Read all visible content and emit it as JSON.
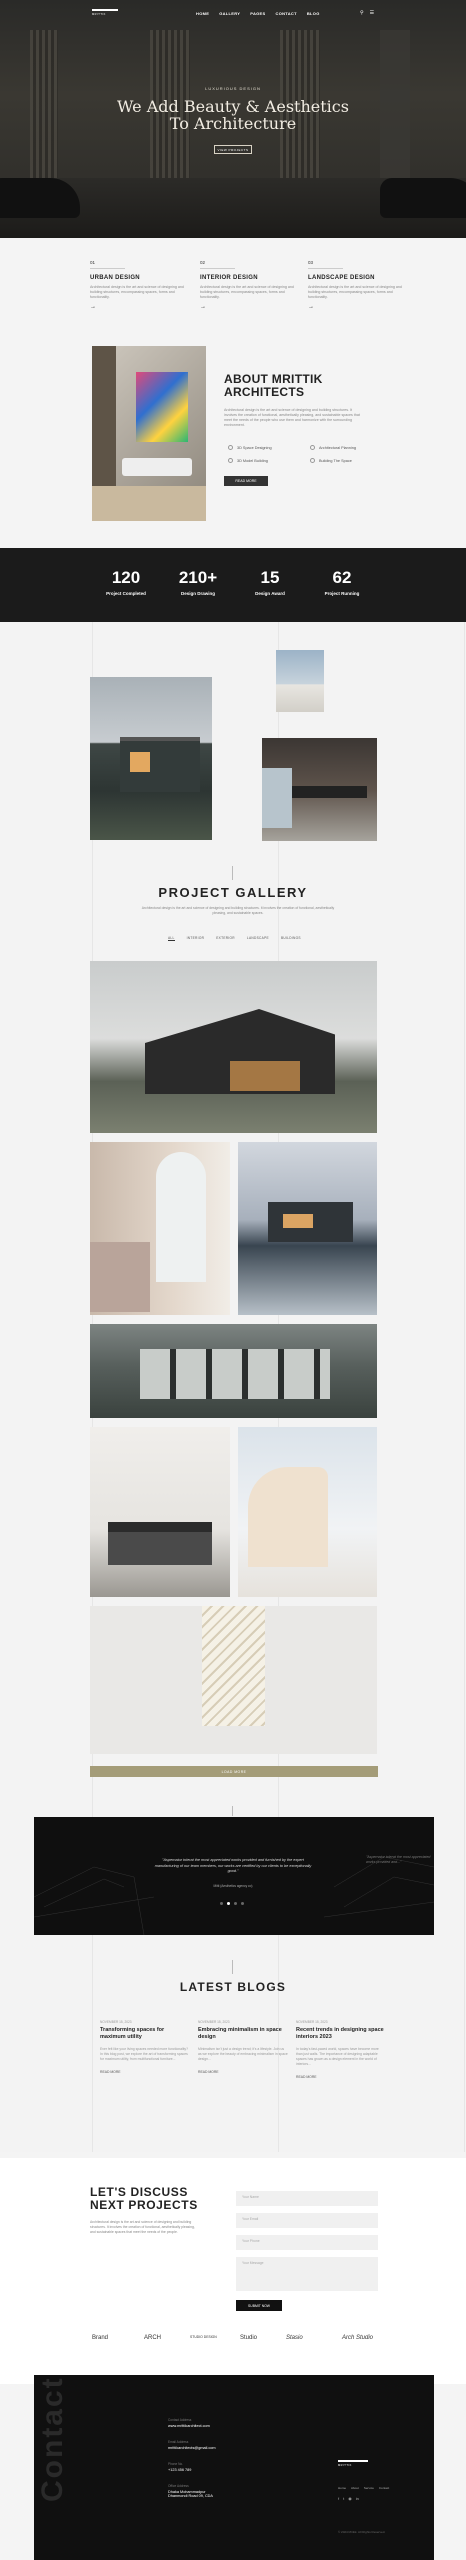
{
  "header": {
    "logo_text": "MRITTIK",
    "nav": [
      "HOME",
      "GALLERY",
      "PAGES",
      "CONTACT",
      "BLOG"
    ],
    "eyebrow": "LUXURIOUS DESIGN",
    "title_line1": "We Add Beauty & Aesthetics",
    "title_line2": "To Architecture",
    "cta": "VIEW PROJECTS"
  },
  "services": [
    {
      "num": "01",
      "title": "URBAN DESIGN",
      "desc": "Architectural design is the art and science of designing and building structures, encompassing spaces, forms and functionality."
    },
    {
      "num": "02",
      "title": "INTERIOR DESIGN",
      "desc": "Architectural design is the art and science of designing and building structures, encompassing spaces, forms and functionality."
    },
    {
      "num": "03",
      "title": "LANDSCAPE DESIGN",
      "desc": "Architectural design is the art and science of designing and building structures, encompassing spaces, forms and functionality."
    }
  ],
  "about": {
    "title_line1": "ABOUT MRITTIK",
    "title_line2": "ARCHITECTS",
    "desc": "Architectural design is the art and science of designing and building structures. It involves the creation of functional, aesthetically pleasing, and sustainable spaces that meet the needs of the people who use them and harmonize with the surrounding environment.",
    "features": [
      "3D Space Designing",
      "Architectural Planning",
      "3D Model Building",
      "Building The Space"
    ],
    "button": "READ MORE"
  },
  "stats": [
    {
      "value": "120",
      "label": "Project Completed"
    },
    {
      "value": "210+",
      "label": "Design Drawing"
    },
    {
      "value": "15",
      "label": "Design Award"
    },
    {
      "value": "62",
      "label": "Project Running"
    }
  ],
  "gallery": {
    "title": "PROJECT GALLERY",
    "desc": "Architectural design is the art and science of designing and building structures. It involves the creation of functional, aesthetically pleasing, and sustainable spaces.",
    "filters": [
      "ALL",
      "INTERIOR",
      "EXTERIOR",
      "LANDSCAPE",
      "BUILDINGS"
    ],
    "load_more": "LOAD MORE"
  },
  "testimonial": {
    "quote": "\"Aspernatur tolerat the most appreciated works provided and furnished by the expert manufacturing of our team members, our works are certified by our clients to be exceptionally good.\"",
    "side_quote": "\"Aspernatur tolerat the most appreciated works provided and...\"",
    "author": "Mitti (Aesthetics agency co)"
  },
  "blogs": {
    "title": "LATEST BLOGS",
    "items": [
      {
        "date": "NOVEMBER 15, 2023",
        "title": "Transforming spaces for maximum utility",
        "excerpt": "Ever felt like your living spaces needed more functionality? In this blog post, we explore the art of transforming spaces for maximum utility, from multifunctional furniture...",
        "more": "READ MORE"
      },
      {
        "date": "NOVEMBER 15, 2023",
        "title": "Embracing minimalism in space design",
        "excerpt": "Minimalism isn't just a design trend; it's a lifestyle. Join us as we explore the beauty of embracing minimalism in space design...",
        "more": "READ MORE"
      },
      {
        "date": "NOVEMBER 15, 2023",
        "title": "Recent trends in designing space interiors 2023",
        "excerpt": "In today's fast-paced world, spaces have become more than just walls. The importance of designing adaptable spaces has grown as a design element in the world of interiors...",
        "more": "READ MORE"
      }
    ]
  },
  "discuss": {
    "title_line1": "LET'S DISCUSS",
    "title_line2": "NEXT PROJECTS",
    "desc": "Architectural design is the art and science of designing and building structures. It involves the creation of functional, aesthetically pleasing, and sustainable spaces that meet the needs of the people.",
    "fields": [
      "Your Name",
      "Your Email",
      "Your Phone",
      "Your Message"
    ],
    "submit": "SUBMIT NOW",
    "brands": [
      "Brand",
      "ARCH",
      "STUDIO DESIGN",
      "Studio",
      "Stasio",
      "Arch Studio"
    ]
  },
  "footer": {
    "contact_word": "Contact",
    "address_label": "Contact Address",
    "address": "www.mrittikarchitect.com",
    "email_label": "Email Address",
    "email": "mrittikarchitects@gmail.com",
    "phone_label": "Phone No.",
    "phone": "+123 456 789",
    "office_label": "Office Address",
    "office": "Dhaka Mohammadpur",
    "office2": "Dhanmondi Road 09, CDA",
    "logo_text": "MRITTIK",
    "nav": [
      "Home",
      "About",
      "Service",
      "Contact"
    ],
    "copyright": "© 2024 Mrittik. All Rights Reserved."
  }
}
